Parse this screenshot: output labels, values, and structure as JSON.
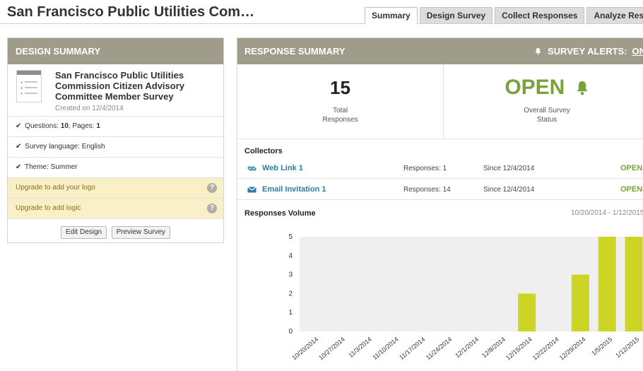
{
  "header": {
    "survey_title": "San Francisco Public Utilities Com…",
    "tabs": [
      {
        "label": "Summary",
        "active": true
      },
      {
        "label": "Design Survey",
        "active": false
      },
      {
        "label": "Collect Responses",
        "active": false
      },
      {
        "label": "Analyze Results",
        "active": false
      }
    ]
  },
  "design_summary": {
    "heading": "DESIGN SUMMARY",
    "survey_name": "San Francisco Public Utilities Commission Citizen Advisory Committee Member Survey",
    "created": "Created on 12/4/2014",
    "questions_label": "Questions: ",
    "questions_count": "10",
    "pages_label": ", Pages: ",
    "pages_count": "1",
    "language": "Survey language: English",
    "theme": "Theme: Summer",
    "upgrade_logo": "Upgrade to add your logo",
    "upgrade_logic": "Upgrade to add logic",
    "help_glyph": "?",
    "edit_button": "Edit Design",
    "preview_button": "Preview Survey"
  },
  "response_summary": {
    "heading": "RESPONSE SUMMARY",
    "alerts_label": "SURVEY ALERTS:",
    "alerts_state": "ON",
    "total_responses": "15",
    "total_label_line1": "Total",
    "total_label_line2": "Responses",
    "status": "OPEN",
    "status_label_line1": "Overall Survey",
    "status_label_line2": "Status",
    "collectors_title": "Collectors",
    "collectors": [
      {
        "name": "Web Link 1",
        "icon": "link-icon",
        "responses": "Responses: 1",
        "since": "Since 12/4/2014",
        "status": "OPEN"
      },
      {
        "name": "Email Invitation 1",
        "icon": "envelope-icon",
        "responses": "Responses: 14",
        "since": "Since 12/4/2014",
        "status": "OPEN"
      }
    ],
    "volume_title": "Responses Volume",
    "volume_range": "10/20/2014 - 1/12/2015"
  },
  "colors": {
    "header_bg": "#9f9c8c",
    "open_green": "#79a23a",
    "bar_color": "#ccd424",
    "link_blue": "#2a7fa3",
    "upgrade_bg": "#faf0c8"
  },
  "chart_data": {
    "type": "bar",
    "categories": [
      "10/20/2014",
      "10/27/2014",
      "11/3/2014",
      "11/10/2014",
      "11/17/2014",
      "11/24/2014",
      "12/1/2014",
      "12/8/2014",
      "12/15/2014",
      "12/22/2014",
      "12/29/2014",
      "1/5/2015",
      "1/12/2015"
    ],
    "values": [
      0,
      0,
      0,
      0,
      0,
      0,
      0,
      0,
      2,
      0,
      3,
      5,
      5
    ],
    "yticks": [
      0,
      1,
      2,
      3,
      4,
      5
    ],
    "ylim": [
      0,
      5
    ],
    "grid": false
  }
}
